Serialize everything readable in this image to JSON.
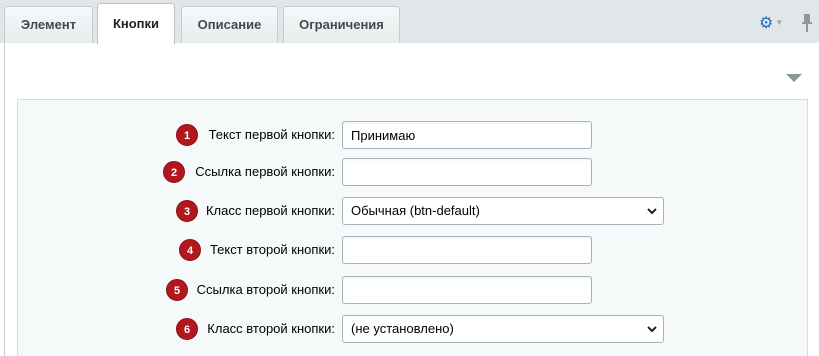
{
  "tabs": [
    {
      "label": "Элемент",
      "active": false
    },
    {
      "label": "Кнопки",
      "active": true
    },
    {
      "label": "Описание",
      "active": false
    },
    {
      "label": "Ограничения",
      "active": false
    }
  ],
  "toolbar": {
    "gear_icon": "gear-icon",
    "pin_icon": "pin-icon",
    "collapse_icon": "chevron-down-icon"
  },
  "colors": {
    "badge": "#b1181d",
    "accent": "#1e6ebd",
    "panel_bg": "#f5f9f9",
    "tabbar_bg": "#e1e7e9"
  },
  "form": {
    "rows": [
      {
        "badge": "1",
        "label": "Текст первой кнопки:",
        "type": "text",
        "value": "Принимаю"
      },
      {
        "badge": "2",
        "label": "Ссылка первой кнопки:",
        "type": "text",
        "value": ""
      },
      {
        "badge": "3",
        "label": "Класс первой кнопки:",
        "type": "select",
        "value": "Обычная (btn-default)"
      },
      {
        "badge": "4",
        "label": "Текст второй кнопки:",
        "type": "text",
        "value": ""
      },
      {
        "badge": "5",
        "label": "Ссылка второй кнопки:",
        "type": "text",
        "value": ""
      },
      {
        "badge": "6",
        "label": "Класс второй кнопки:",
        "type": "select",
        "value": "(не установлено)"
      }
    ]
  }
}
